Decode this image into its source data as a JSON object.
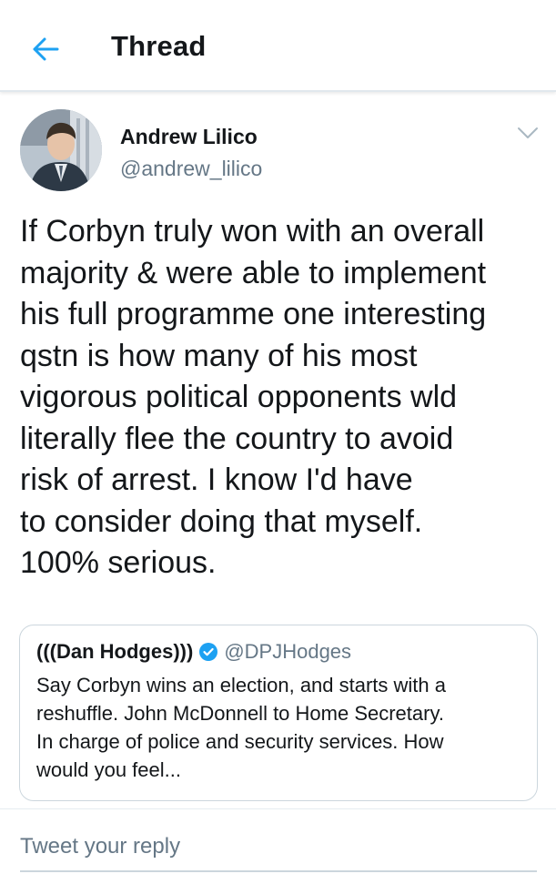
{
  "header": {
    "title": "Thread",
    "back_icon": "arrow-left-icon",
    "accent_color": "#1da1f2"
  },
  "tweet": {
    "author_name": "Andrew Lilico",
    "author_handle": "@andrew_lilico",
    "more_icon": "chevron-down-icon",
    "text_lines": [
      "If Corbyn truly won with an overall",
      "majority & were able to implement",
      "his full programme one interesting",
      "qstn is how many of his most",
      "vigorous political opponents wld",
      "literally flee the country to avoid",
      "risk of arrest. I know I'd have",
      "to consider doing that myself.",
      "100% serious."
    ]
  },
  "quoted_tweet": {
    "author_name": "(((Dan Hodges)))",
    "verified_icon": "verified-badge-icon",
    "author_handle": "@DPJHodges",
    "text_lines": [
      "Say Corbyn wins an election, and starts with a",
      "reshuffle. John McDonnell to Home Secretary.",
      "In charge of police and security services. How",
      "would you feel..."
    ]
  },
  "reply": {
    "placeholder": "Tweet your reply"
  }
}
